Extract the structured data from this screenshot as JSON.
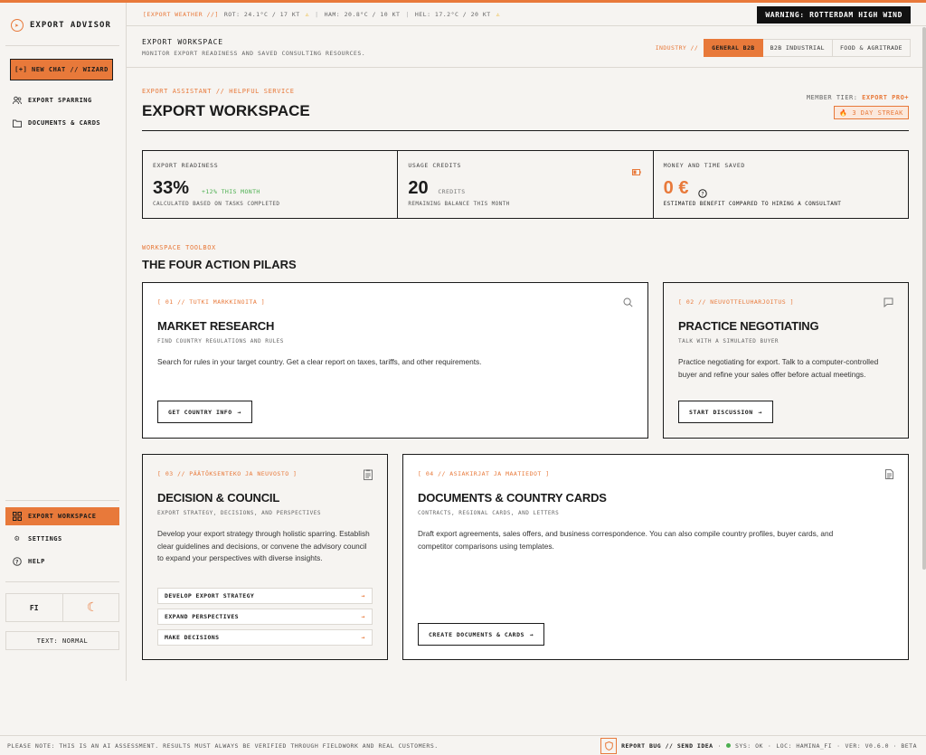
{
  "app": {
    "title": "EXPORT ADVISOR"
  },
  "sidebar": {
    "new_chat": "[+] NEW CHAT // WIZARD",
    "items": [
      {
        "label": "EXPORT SPARRING",
        "icon": "users-icon"
      },
      {
        "label": "DOCUMENTS & CARDS",
        "icon": "folder-icon"
      }
    ],
    "bottom_items": [
      {
        "label": "EXPORT WORKSPACE",
        "icon": "grid-icon",
        "active": true
      },
      {
        "label": "SETTINGS",
        "icon": "gear-icon"
      },
      {
        "label": "HELP",
        "icon": "help-icon"
      }
    ],
    "language": "FI",
    "text_size": "TEXT: NORMAL"
  },
  "weather": {
    "label": "[EXPORT WEATHER //]",
    "rot": "ROT: 24.1°C / 17 KT",
    "ham": "HAM: 20.8°C / 10 KT",
    "hel": "HEL: 17.2°C / 20 KT",
    "warning": "WARNING: ROTTERDAM HIGH WIND"
  },
  "workspace_header": {
    "title": "EXPORT WORKSPACE",
    "subtitle": "MONITOR EXPORT READINESS AND SAVED CONSULTING RESOURCES.",
    "industry_label": "INDUSTRY //",
    "industries": [
      "GENERAL B2B",
      "B2B INDUSTRIAL",
      "FOOD & AGRITRADE"
    ],
    "selected_industry": "GENERAL B2B"
  },
  "main": {
    "eyebrow": "EXPORT ASSISTANT // HELPFUL SERVICE",
    "title": "EXPORT WORKSPACE",
    "member_tier_label": "MEMBER TIER:",
    "member_tier": "EXPORT PRO+",
    "streak": "3 DAY STREAK"
  },
  "stats": {
    "readiness": {
      "label": "EXPORT READINESS",
      "value": "33%",
      "delta": "+12% THIS MONTH",
      "desc": "CALCULATED BASED ON TASKS COMPLETED"
    },
    "credits": {
      "label": "USAGE CREDITS",
      "value": "20",
      "unit": "CREDITS",
      "desc": "REMAINING BALANCE THIS MONTH"
    },
    "saved": {
      "label": "MONEY AND TIME SAVED",
      "value": "0 €",
      "desc": "ESTIMATED BENEFIT COMPARED TO HIRING A CONSULTANT"
    }
  },
  "toolbox": {
    "eyebrow": "WORKSPACE TOOLBOX",
    "title": "THE FOUR ACTION PILARS"
  },
  "cards": {
    "research": {
      "tag": "[ 01 // TUTKI MARKKINOITA ]",
      "title": "MARKET RESEARCH",
      "subtitle": "FIND COUNTRY REGULATIONS AND RULES",
      "desc": "Search for rules in your target country. Get a clear report on taxes, tariffs, and other requirements.",
      "button": "GET COUNTRY INFO"
    },
    "negotiation": {
      "tag": "[ 02 // NEUVOTTELUHARJOITUS ]",
      "title": "PRACTICE NEGOTIATING",
      "subtitle": "TALK WITH A SIMULATED BUYER",
      "desc": "Practice negotiating for export. Talk to a computer-controlled buyer and refine your sales offer before actual meetings.",
      "button": "START DISCUSSION"
    },
    "council": {
      "tag": "[ 03 // PÄÄTÖKSENTEKO JA NEUVOSTO ]",
      "title": "DECISION & COUNCIL",
      "subtitle": "EXPORT STRATEGY, DECISIONS, AND PERSPECTIVES",
      "desc": "Develop your export strategy through holistic sparring. Establish clear guidelines and decisions, or convene the advisory council to expand your perspectives with diverse insights.",
      "links": [
        "DEVELOP EXPORT STRATEGY",
        "EXPAND PERSPECTIVES",
        "MAKE DECISIONS"
      ]
    },
    "documents": {
      "tag": "[ 04 // ASIAKIRJAT JA MAATIEDOT ]",
      "title": "DOCUMENTS & COUNTRY CARDS",
      "subtitle": "CONTRACTS, REGIONAL CARDS, AND LETTERS",
      "desc": "Draft export agreements, sales offers, and business correspondence. You can also compile country profiles, buyer cards, and competitor comparisons using templates.",
      "button": "CREATE DOCUMENTS & CARDS"
    }
  },
  "footer": {
    "disclaimer": "PLEASE NOTE: THIS IS AN AI ASSESSMENT. RESULTS MUST ALWAYS BE VERIFIED THROUGH FIELDWORK AND REAL CUSTOMERS.",
    "report": "REPORT BUG // SEND IDEA",
    "sys": "SYS: OK",
    "loc": "LOC: HAMINA_FI",
    "ver": "VER: V0.6.0 · BETA"
  },
  "colors": {
    "accent": "#e8793a",
    "ink": "#1b1b1b",
    "paper": "#f6f4f1",
    "ok": "#4caf50"
  }
}
